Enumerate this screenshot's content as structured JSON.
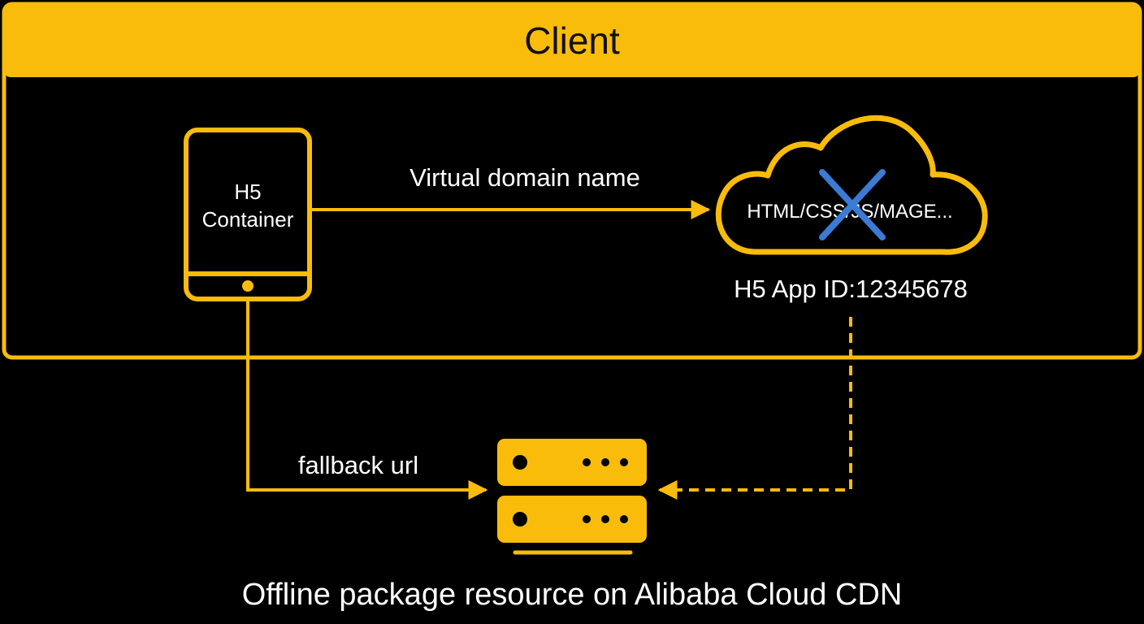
{
  "client": {
    "title": "Client"
  },
  "container": {
    "line1": "H5",
    "line2": "Container"
  },
  "cloud": {
    "resources": "HTML/CSS/JS/MAGE...",
    "app_id": "H5 App ID:12345678"
  },
  "edges": {
    "virtual_domain": "Virtual domain name",
    "fallback": "fallback url"
  },
  "cdn": {
    "caption": "Offline package resource on Alibaba Cloud CDN"
  },
  "colors": {
    "accent": "#F9BC0A",
    "background": "#000000",
    "text": "#FFFFFF",
    "title_text": "#111111",
    "cross": "#3A7BD5"
  }
}
